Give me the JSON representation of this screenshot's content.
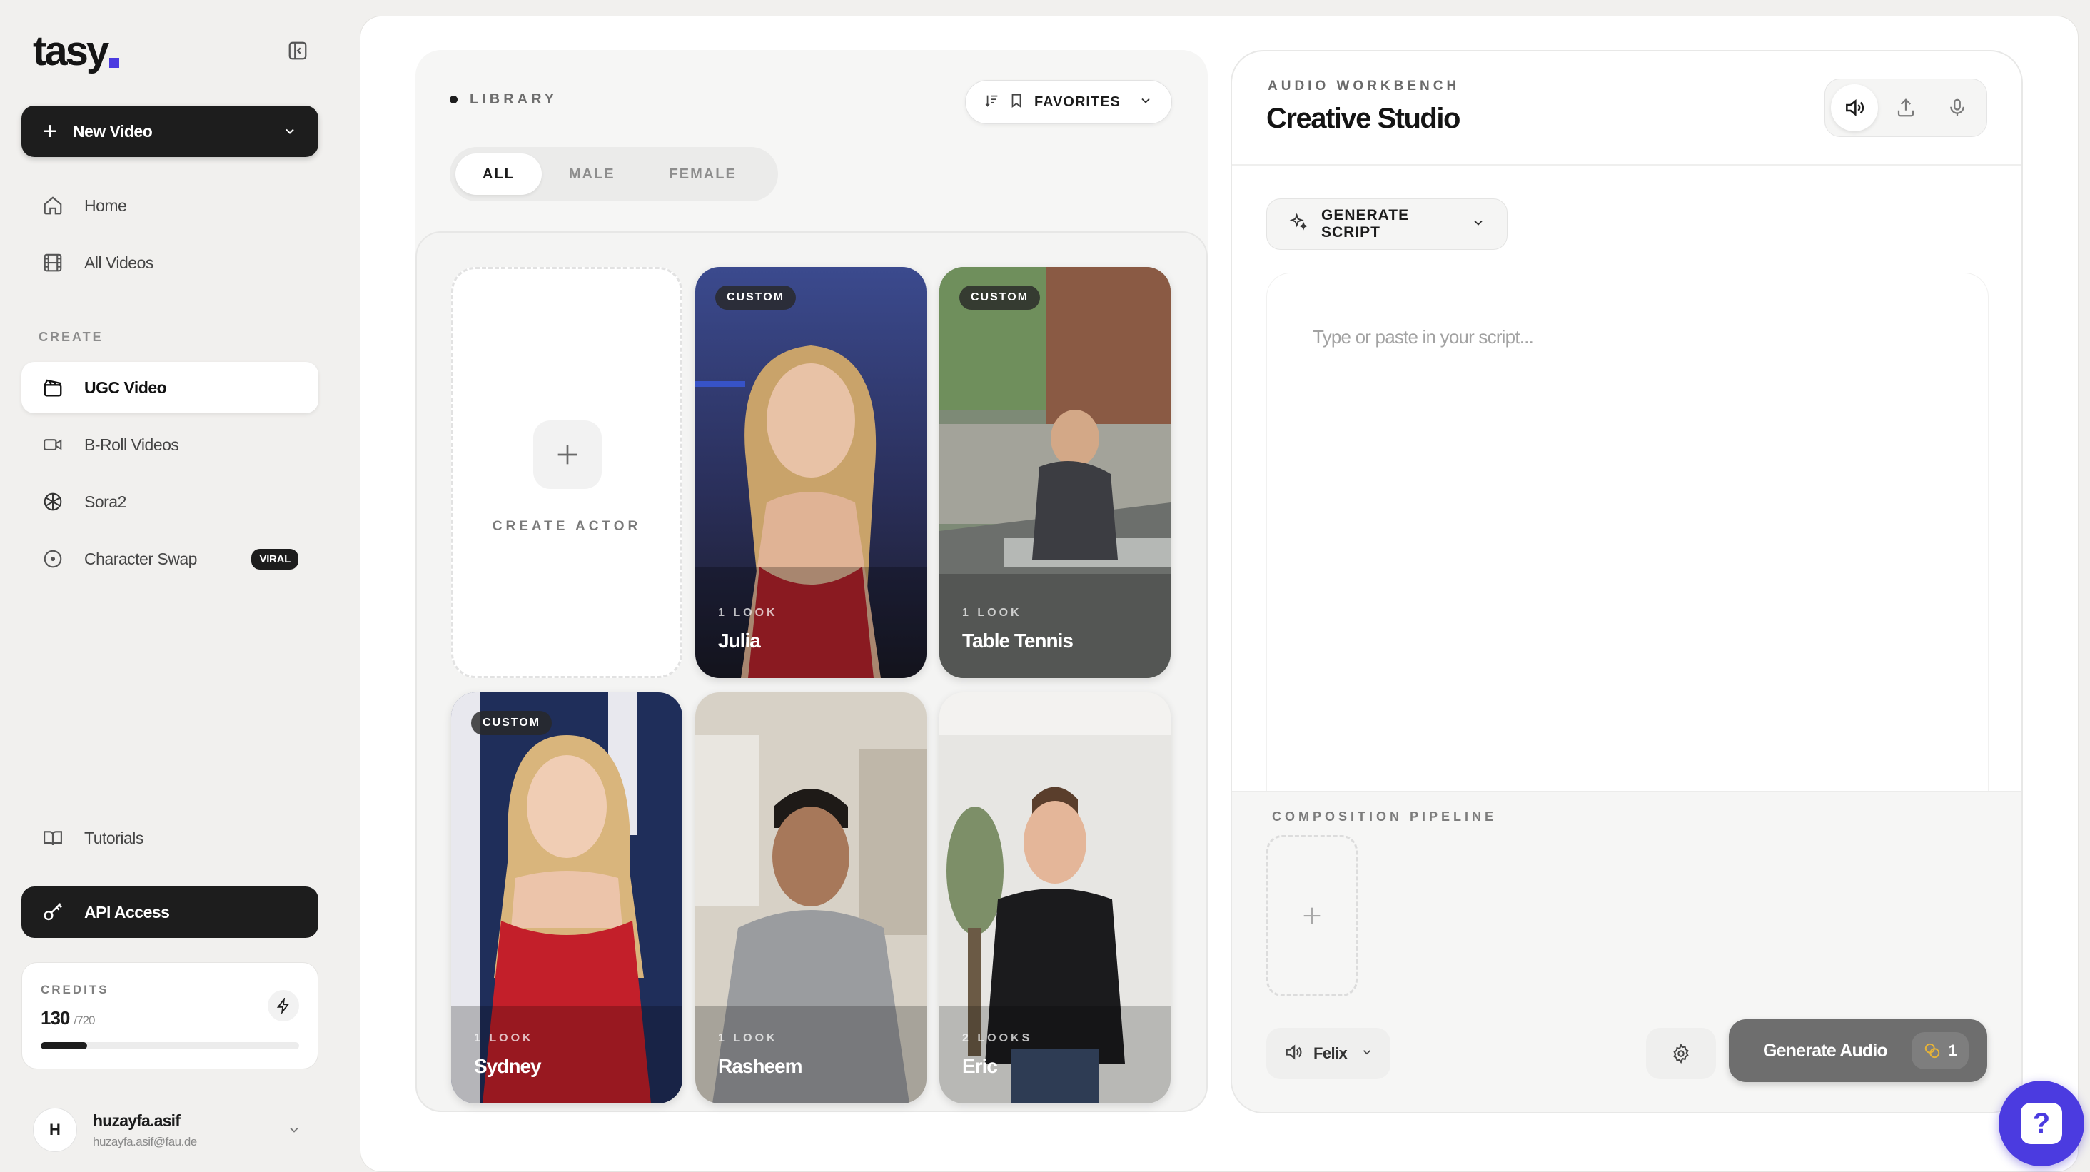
{
  "app": {
    "logo": "tasy"
  },
  "sidebar": {
    "new_video": "New Video",
    "nav": [
      {
        "label": "Home",
        "icon": "home-icon"
      },
      {
        "label": "All Videos",
        "icon": "film-icon"
      }
    ],
    "create_label": "CREATE",
    "create_items": [
      {
        "label": "UGC Video",
        "icon": "clapper-icon",
        "active": true
      },
      {
        "label": "B-Roll Videos",
        "icon": "video-camera-icon"
      },
      {
        "label": "Sora2",
        "icon": "openai-icon"
      },
      {
        "label": "Character Swap",
        "icon": "circle-dot-icon",
        "badge": "VIRAL"
      }
    ],
    "tutorials": "Tutorials",
    "api_access": "API Access",
    "credits": {
      "label": "CREDITS",
      "value": "130",
      "total": "/720",
      "fraction": 0.18
    },
    "user": {
      "initial": "H",
      "name": "huzayfa.asif",
      "email": "huzayfa.asif@fau.de"
    }
  },
  "library": {
    "title": "LIBRARY",
    "favorites": "FAVORITES",
    "filters": [
      "ALL",
      "MALE",
      "FEMALE"
    ],
    "active_filter": "ALL",
    "create_actor": "CREATE ACTOR",
    "actors": [
      {
        "name": "Julia",
        "looks": "1 LOOK",
        "badge": "CUSTOM"
      },
      {
        "name": "Table Tennis",
        "looks": "1 LOOK",
        "badge": "CUSTOM"
      },
      {
        "name": "Sydney",
        "looks": "1 LOOK",
        "badge": "CUSTOM"
      },
      {
        "name": "Rasheem",
        "looks": "1 LOOK",
        "badge": ""
      },
      {
        "name": "Eric",
        "looks": "2 LOOKS",
        "badge": ""
      }
    ]
  },
  "workbench": {
    "label": "AUDIO WORKBENCH",
    "title": "Creative Studio",
    "generate_script": "GENERATE SCRIPT",
    "script_placeholder": "Type or paste in your script...",
    "pipeline_label": "COMPOSITION PIPELINE",
    "voice": "Felix",
    "generate_audio": "Generate Audio",
    "cost": "1"
  },
  "colors": {
    "accent": "#4b3be0",
    "dark": "#1d1d1d"
  }
}
